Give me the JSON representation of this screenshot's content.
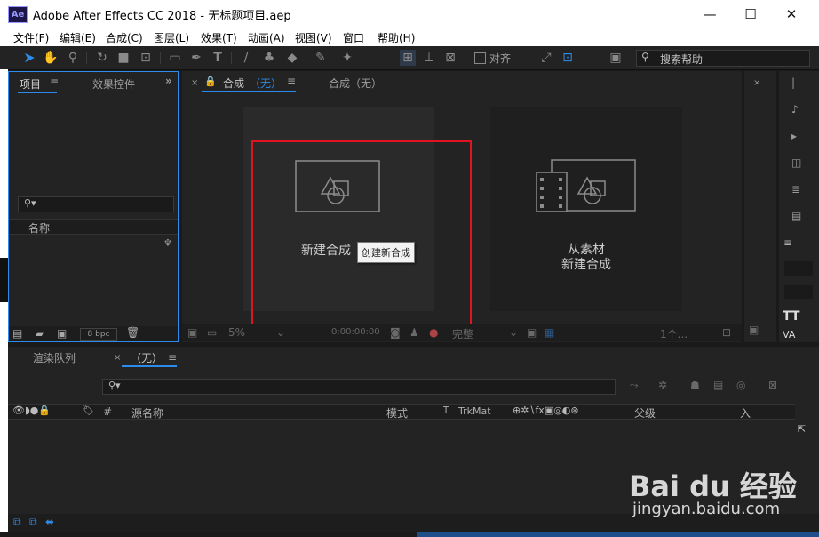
{
  "window": {
    "title": "Adobe After Effects CC 2018 - 无标题项目.aep",
    "app_icon": "Ae",
    "controls": {
      "minimize": "—",
      "maximize": "☐",
      "close": "✕"
    }
  },
  "menu": [
    "文件(F)",
    "编辑(E)",
    "合成(C)",
    "图层(L)",
    "效果(T)",
    "动画(A)",
    "视图(V)",
    "窗口",
    "帮助(H)"
  ],
  "toolbar": {
    "align_label": "对齐",
    "search_placeholder": "搜索帮助"
  },
  "project_panel": {
    "tab_project": "项目",
    "tab_effects": "效果控件",
    "column_name": "名称",
    "bpc": "8 bpc"
  },
  "composition_panel": {
    "tab_active_prefix": "合成",
    "tab_active_value": "（无）",
    "tab_inactive": "合成（无）",
    "new_comp_label": "新建合成",
    "tooltip": "创建新合成",
    "from_footage_line1": "从素材",
    "from_footage_line2": "新建合成",
    "zoom": "5%",
    "timecode": "0:00:00:00",
    "resolution": "完整",
    "views": "1个..."
  },
  "timeline_panel": {
    "tab_render": "渲染队列",
    "tab_active": "（无）",
    "columns": [
      "#",
      "源名称",
      "模式",
      "T",
      "TrkMat",
      "父级",
      "入"
    ]
  },
  "watermark": {
    "brand": "Bai du 经验",
    "url": "jingyan.baidu.com"
  },
  "colors": {
    "accent_blue": "#2d8ceb",
    "highlight_red": "#e0141e",
    "panel_bg": "#232323"
  }
}
